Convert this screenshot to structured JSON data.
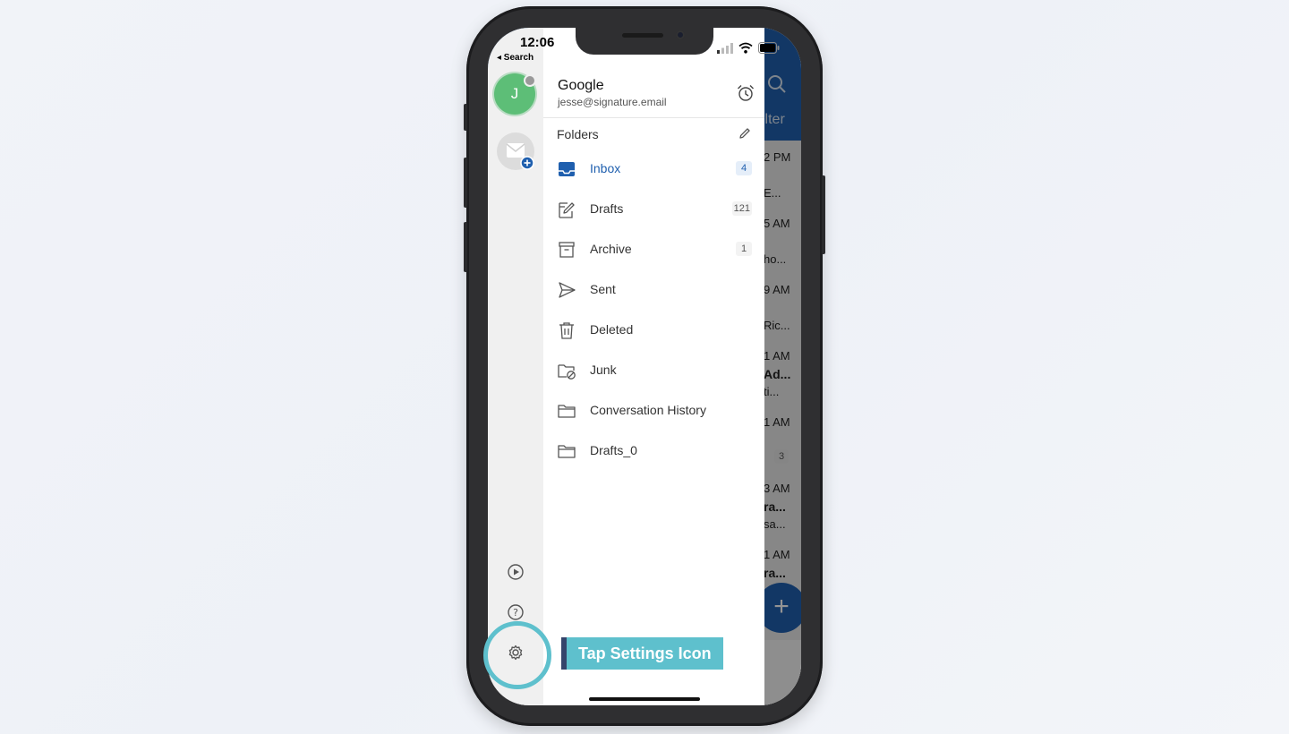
{
  "status_bar": {
    "time": "12:06",
    "back_label": "◂ Search"
  },
  "account": {
    "initial": "J",
    "name": "Google",
    "email": "jesse@signature.email"
  },
  "folders_header": "Folders",
  "folders": [
    {
      "label": "Inbox",
      "count": "4",
      "icon": "inbox-icon",
      "active": true
    },
    {
      "label": "Drafts",
      "count": "121",
      "icon": "drafts-icon"
    },
    {
      "label": "Archive",
      "count": "1",
      "icon": "archive-icon"
    },
    {
      "label": "Sent",
      "count": "",
      "icon": "sent-icon"
    },
    {
      "label": "Deleted",
      "count": "",
      "icon": "trash-icon"
    },
    {
      "label": "Junk",
      "count": "",
      "icon": "junk-icon"
    },
    {
      "label": "Conversation History",
      "count": "",
      "icon": "folder-icon"
    },
    {
      "label": "Drafts_0",
      "count": "",
      "icon": "folder-icon"
    }
  ],
  "background_list": {
    "filter": "ilter",
    "times": [
      "2 PM",
      "5 AM",
      "9 AM",
      "1 AM",
      "1 AM",
      "3 AM",
      "1 AM"
    ],
    "snippets": [
      "E...",
      "ho...",
      "Ric...",
      "Ad...",
      "ti...",
      "ra...",
      "sa...",
      "ra..."
    ],
    "badge": "3"
  },
  "callout": {
    "text": "Tap Settings Icon"
  },
  "colors": {
    "accent": "#1f5fae",
    "callout": "#5ec0cd",
    "callout_bar": "#35446b",
    "avatar": "#5dbe77"
  }
}
